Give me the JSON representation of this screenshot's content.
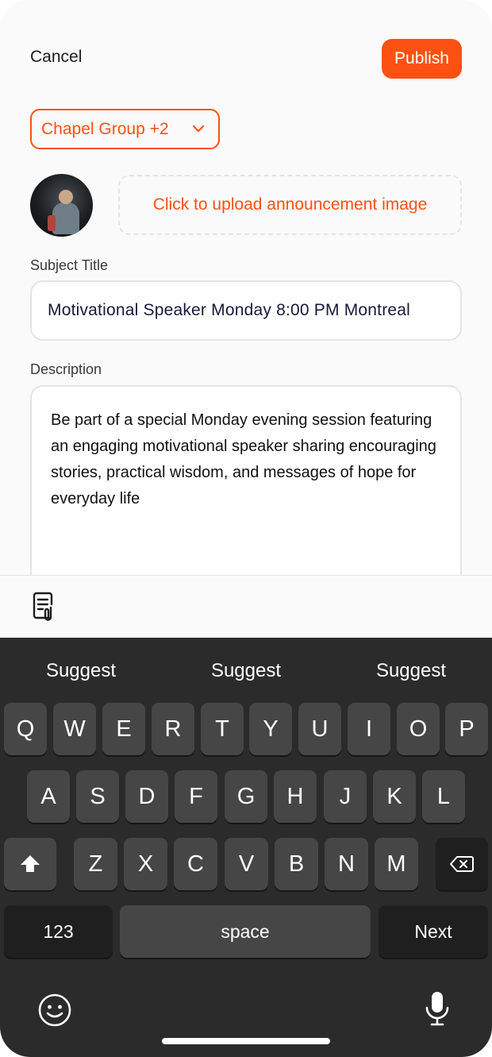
{
  "header": {
    "cancel_label": "Cancel",
    "publish_label": "Publish"
  },
  "audience": {
    "selected": "Chapel Group +2"
  },
  "upload": {
    "label": "Click to upload announcement image"
  },
  "subject": {
    "label": "Subject Title",
    "value": "Motivational Speaker  Monday 8:00 PM Montreal"
  },
  "description": {
    "label": "Description",
    "value": "Be part of a special Monday evening session featuring an engaging motivational speaker sharing encouraging stories, practical wisdom, and messages of hope for everyday life"
  },
  "toolbar": {
    "icon": "document-attachment-icon"
  },
  "keyboard": {
    "suggestions": [
      "Suggest",
      "Suggest",
      "Suggest"
    ],
    "row1": [
      "Q",
      "W",
      "E",
      "R",
      "T",
      "Y",
      "U",
      "I",
      "O",
      "P"
    ],
    "row2": [
      "A",
      "S",
      "D",
      "F",
      "G",
      "H",
      "J",
      "K",
      "L"
    ],
    "row3": [
      "Z",
      "X",
      "C",
      "V",
      "B",
      "N",
      "M"
    ],
    "numbers_label": "123",
    "space_label": "space",
    "next_label": "Next",
    "shift_icon": "shift-icon",
    "delete_icon": "backspace-icon",
    "emoji_icon": "emoji-icon",
    "mic_icon": "microphone-icon"
  },
  "colors": {
    "accent": "#fc5113",
    "keyboard_bg": "#2b2b2b",
    "key_bg": "#464646",
    "key_dark_bg": "#1f1f1f"
  }
}
